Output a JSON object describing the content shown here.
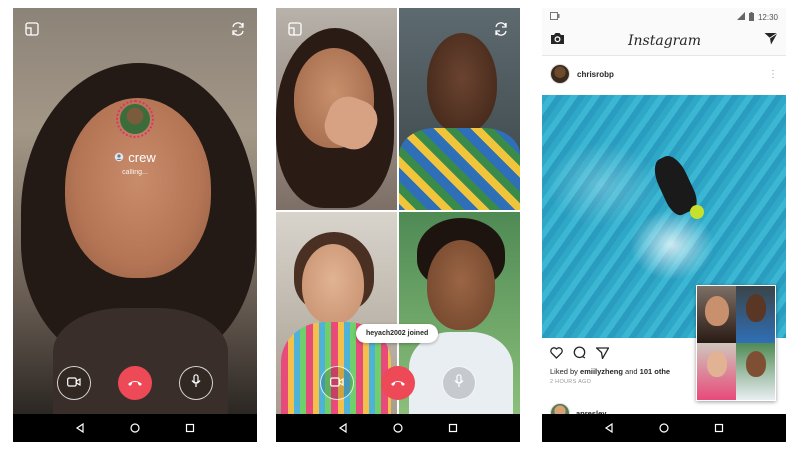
{
  "colors": {
    "end_call": "#ed4956",
    "instagram_text": "#262626",
    "story_ring": "#e1306c"
  },
  "phone1": {
    "icons": {
      "top_left": "gallery-icon",
      "top_right": "flip-camera-icon"
    },
    "caller": {
      "name": "crew",
      "status": "calling..."
    },
    "controls": [
      "video-icon",
      "end-call-icon",
      "microphone-icon"
    ]
  },
  "phone2": {
    "icons": {
      "top_left": "gallery-icon",
      "top_right": "flip-camera-icon"
    },
    "toast": "heyach2002 joined",
    "controls": [
      "video-icon",
      "end-call-icon",
      "microphone-icon"
    ]
  },
  "phone3": {
    "status_bar": {
      "time": "12:30"
    },
    "header": {
      "logo": "Instagram",
      "left_icon": "camera-icon",
      "right_icon": "direct-message-icon"
    },
    "post": {
      "username": "chrisrobp",
      "liked_prefix": "Liked by ",
      "liked_user": "emiilyzheng",
      "liked_middle": " and ",
      "liked_count": "101 othe",
      "time_ago": "2 HOURS AGO"
    },
    "next_post": {
      "username": "apresley"
    }
  },
  "navbar": [
    "back-icon",
    "home-icon",
    "recents-icon"
  ]
}
